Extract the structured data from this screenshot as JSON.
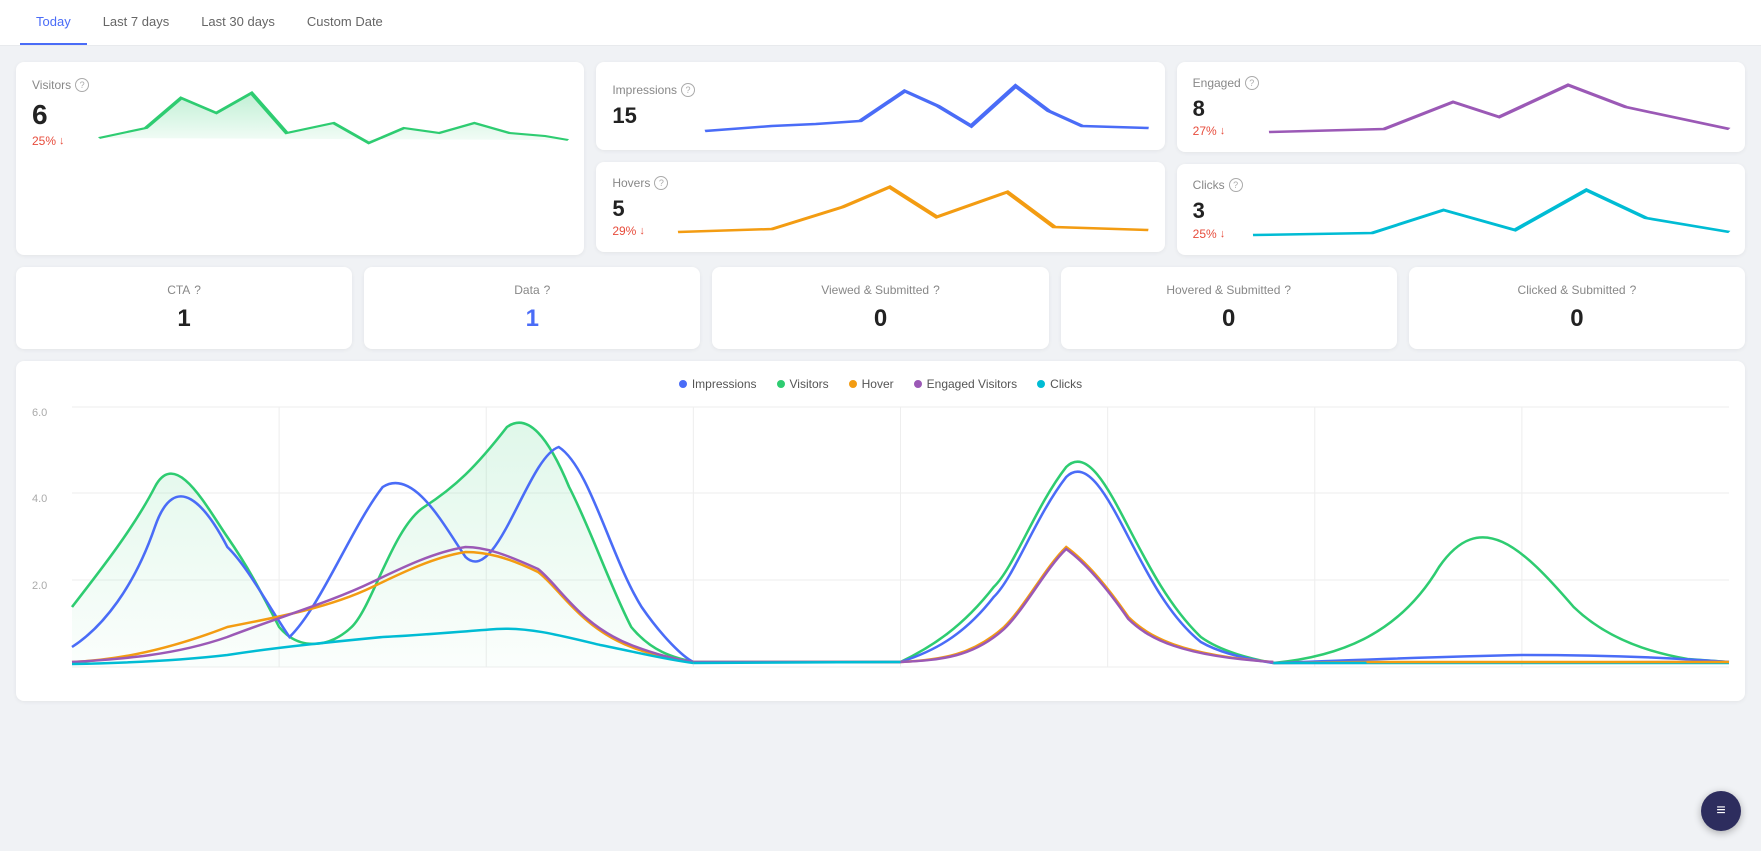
{
  "nav": {
    "tabs": [
      {
        "label": "Today",
        "active": true
      },
      {
        "label": "Last 7 days",
        "active": false
      },
      {
        "label": "Last 30 days",
        "active": false
      },
      {
        "label": "Custom Date",
        "active": false
      }
    ]
  },
  "visitors": {
    "label": "Visitors",
    "value": "6",
    "change": "25%",
    "change_direction": "down"
  },
  "impressions": {
    "label": "Impressions",
    "value": "15"
  },
  "hovers": {
    "label": "Hovers",
    "value": "5",
    "change": "29%",
    "change_direction": "down"
  },
  "engaged": {
    "label": "Engaged",
    "value": "8",
    "change": "27%",
    "change_direction": "down"
  },
  "clicks": {
    "label": "Clicks",
    "value": "3",
    "change": "25%",
    "change_direction": "down"
  },
  "stats": {
    "cta": {
      "label": "CTA",
      "value": "1"
    },
    "data": {
      "label": "Data",
      "value": "1",
      "is_link": true
    },
    "viewed_submitted": {
      "label": "Viewed & Submitted",
      "value": "0"
    },
    "hovered_submitted": {
      "label": "Hovered & Submitted",
      "value": "0"
    },
    "clicked_submitted": {
      "label": "Clicked & Submitted",
      "value": "0"
    }
  },
  "legend": [
    {
      "label": "Impressions",
      "color": "#4a6cf7"
    },
    {
      "label": "Visitors",
      "color": "#2ecc71"
    },
    {
      "label": "Hover",
      "color": "#f39c12"
    },
    {
      "label": "Engaged Visitors",
      "color": "#9b59b6"
    },
    {
      "label": "Clicks",
      "color": "#00bcd4"
    }
  ],
  "chart": {
    "y_labels": [
      "6.0",
      "4.0",
      "2.0",
      ""
    ]
  },
  "colors": {
    "accent": "#4a6cf7",
    "green": "#2ecc71",
    "orange": "#f39c12",
    "purple": "#9b59b6",
    "cyan": "#00bcd4",
    "red": "#e74c3c"
  }
}
